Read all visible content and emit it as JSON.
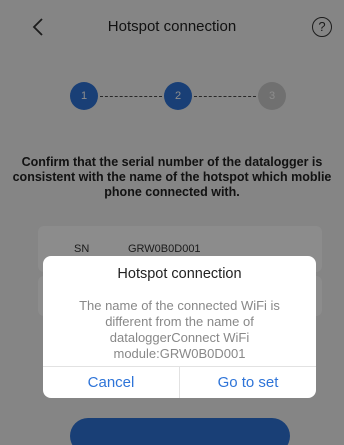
{
  "header": {
    "title": "Hotspot connection",
    "help_label": "?"
  },
  "stepper": {
    "steps": [
      {
        "label": "1",
        "state": "active"
      },
      {
        "label": "2",
        "state": "active"
      },
      {
        "label": "3",
        "state": "inactive"
      }
    ]
  },
  "main": {
    "instruction": "Confirm that the serial number of the datalogger is consistent with the name of the hotspot which moblie phone connected with.",
    "sn_label": "SN",
    "sn_value": "GRW0B0D001"
  },
  "dialog": {
    "title": "Hotspot connection",
    "message": "The name of the connected WiFi is different from the name of dataloggerConnect WiFi module:GRW0B0D001",
    "cancel_label": "Cancel",
    "confirm_label": "Go to set"
  },
  "colors": {
    "accent": "#2e74d8",
    "overlay": "rgba(0,0,0,0.45)"
  }
}
